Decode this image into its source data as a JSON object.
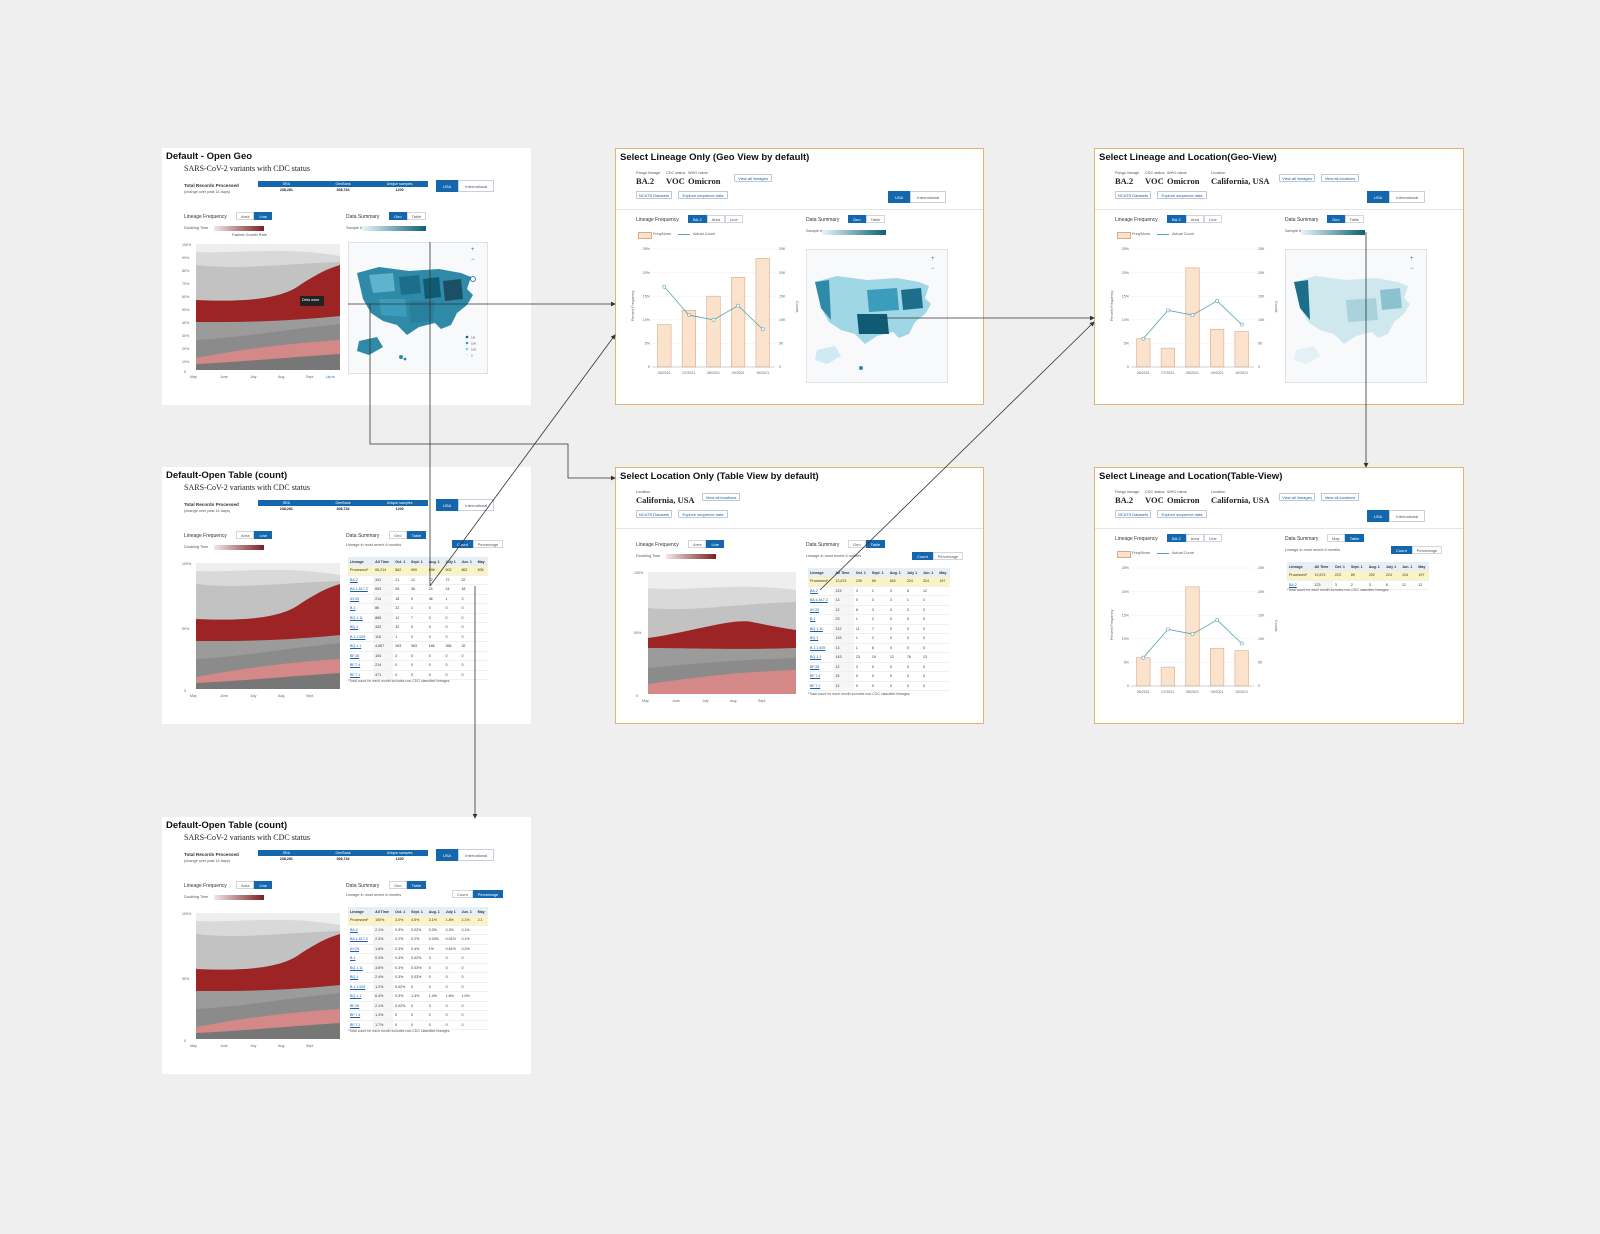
{
  "frames": {
    "f1": {
      "title": "Default - Open Geo",
      "subtitle": "SARS-CoV-2 variants with CDC status"
    },
    "f2": {
      "title": "Default-Open Table (count)",
      "subtitle": "SARS-CoV-2 variants with CDC status"
    },
    "f3": {
      "title": "Default-Open Table (count)",
      "subtitle": "SARS-CoV-2 variants with CDC status"
    },
    "f4": {
      "title": "Select Lineage Only (Geo View by default)"
    },
    "f5": {
      "title": "Select Location Only (Table View by default)"
    },
    "f6": {
      "title": "Select Lineage and Location(Geo-View)"
    },
    "f7": {
      "title": "Select Lineage and Location(Table-View)"
    }
  },
  "common": {
    "total_label": "Total Records Processed",
    "total_sub": "(change over past 14 days)",
    "stat_headers": [
      "SRA",
      "GenBank",
      "Unique samples"
    ],
    "stat_values": [
      "238,281",
      "308,734",
      "1200"
    ],
    "stat_suffix": "(+1.44%)",
    "usa": "USA",
    "international": "International",
    "lineage_frequency": "Lineage Frequency",
    "area": "Area",
    "line": "Line",
    "data_summary": "Data Summary",
    "geo": "Geo",
    "map": "Map",
    "table": "Table",
    "doubling_time": "Doubling Time",
    "fastest_growth": "Fastest Growth Rate",
    "sample_n": "Sample #",
    "sample_ticks": [
      "0",
      "1",
      "100",
      "1K",
      "10K",
      "100K",
      "1M+"
    ],
    "map_legend": [
      "1M",
      "10K",
      "100",
      "0"
    ],
    "lineage_recent": "Lineage in most recent 6 months",
    "count": "Count",
    "percentage": "Percentage",
    "footnote": "*Total count for each month includes non-CDC classified lineages.",
    "tooltip": "Delta wave\n(2/Mar)",
    "x_months": [
      "May\n2021",
      "June\n2021",
      "July\n2021",
      "Aug\n2021",
      "Sept\n2021",
      "Up to\nOct 31, 2021"
    ],
    "y_pct": [
      "100%",
      "90%",
      "80%",
      "70%",
      "60%",
      "50%",
      "40%",
      "30%",
      "20%",
      "10%",
      "0"
    ],
    "pango_label": "Pango lineage",
    "pango_value": "BA.2",
    "cdc_label": "CDC status",
    "cdc_value": "VOC",
    "who_label": "WHO name",
    "who_value": "Omicron",
    "location_label": "Location",
    "location_value": "California, USA",
    "view_all_lineages": "View all lineages",
    "view_all_locations": "View all locations",
    "ncats": "NCATS Datasets",
    "explore": "Explore sequence data",
    "ba2_tab": "BA.2",
    "freq_legend": "Freq/Norm",
    "actual_count": "Actual Count",
    "percent_frequency": "Percent Frequency",
    "counts_axis": "Counts",
    "bar_y_ticks": [
      "25%",
      "20%",
      "15%",
      "10%",
      "5%",
      "0"
    ],
    "bar_y2_ticks": [
      "25K",
      "20K",
      "15K",
      "10K",
      "5K",
      "0"
    ]
  },
  "table_count": {
    "headers": [
      "Lineage",
      "All Time",
      "Oct. 1",
      "Sept. 1",
      "Aug. 1",
      "July 1",
      "Jun. 1",
      "May"
    ],
    "rows": [
      [
        "Processed*",
        "65,214",
        "562",
        "690",
        "698",
        "502",
        "862",
        "836"
      ],
      [
        "BA.2",
        "341",
        "21",
        "12",
        "72",
        "72",
        "22",
        ""
      ],
      [
        "BA.1.617.2",
        "603",
        "26",
        "36",
        "24",
        "24",
        "18",
        ""
      ],
      [
        "AY.25",
        "214",
        "18",
        "9",
        "46",
        "1",
        "3",
        ""
      ],
      [
        "B.1",
        "86",
        "22",
        "1",
        "0",
        "0",
        "0",
        ""
      ],
      [
        "BQ.1.11",
        "865",
        "12",
        "7",
        "0",
        "0",
        "0",
        ""
      ],
      [
        "BQ.1",
        "432",
        "32",
        "0",
        "0",
        "0",
        "0",
        ""
      ],
      [
        "B.1.1.529",
        "116",
        "1",
        "0",
        "0",
        "0",
        "0",
        ""
      ],
      [
        "BQ.1.1",
        "4,567",
        "263",
        "363",
        "186",
        "366",
        "32",
        ""
      ],
      [
        "BF.26",
        "104",
        "2",
        "0",
        "0",
        "0",
        "0",
        ""
      ],
      [
        "BF.7.4",
        "214",
        "0",
        "0",
        "0",
        "0",
        "0",
        ""
      ],
      [
        "BF.7.1",
        "471",
        "0",
        "0",
        "0",
        "0",
        "0",
        ""
      ]
    ]
  },
  "table_pct": {
    "headers": [
      "Lineage",
      "All Time",
      "Oct. 1",
      "Sept. 1",
      "Aug. 1",
      "July 1",
      "Jun. 1",
      "May"
    ],
    "rows": [
      [
        "Processed*",
        "100%",
        "3.0%",
        "4.5%",
        "3.1%",
        "1.8%",
        "2.1%",
        "2.1"
      ],
      [
        "BA.2",
        "2.1%",
        "0.3%",
        "0.02%",
        "0.3%",
        "0.3%",
        "0.1%",
        ""
      ],
      [
        "BA.1.617.2",
        "2.3%",
        "0.2%",
        "0.2%",
        "0.03%",
        "0.01%",
        "0.1%",
        ""
      ],
      [
        "AY.25",
        "1.8%",
        "0.3%",
        "0.4%",
        "1%",
        "0.61%",
        "0.2%",
        ""
      ],
      [
        "B.1",
        "0.3%",
        "0.3%",
        "0.02%",
        "0",
        "0",
        "0",
        ""
      ],
      [
        "BQ.1.11",
        "3.6%",
        "0.3%",
        "0.03%",
        "0",
        "0",
        "0",
        ""
      ],
      [
        "BQ.1",
        "2.4%",
        "0.3%",
        "0.03%",
        "0",
        "0",
        "0",
        ""
      ],
      [
        "B.1.1.529",
        "1.2%",
        "0.02%",
        "0",
        "0",
        "0",
        "0",
        ""
      ],
      [
        "BQ.1.1",
        "6.4%",
        "0.3%",
        "1.4%",
        "1.4%",
        "1.6%",
        "1.0%",
        ""
      ],
      [
        "BF.26",
        "2.1%",
        "0.02%",
        "0",
        "0",
        "0",
        "0",
        ""
      ],
      [
        "BF.7.4",
        "1.3%",
        "0",
        "0",
        "0",
        "0",
        "0",
        ""
      ],
      [
        "BF.7.1",
        "1.7%",
        "0",
        "0",
        "0",
        "0",
        "0",
        ""
      ]
    ]
  },
  "table_loc": {
    "headers": [
      "Lineage",
      "All Time",
      "Oct. 1",
      "Sept. 1",
      "Aug. 1",
      "July 1",
      "Jun. 1",
      "May"
    ],
    "rows": [
      [
        "Processed*",
        "12,674",
        "235",
        "89",
        "602",
        "224",
        "324",
        "197"
      ],
      [
        "BA.2",
        "123",
        "3",
        "2",
        "3",
        "6",
        "12",
        ""
      ],
      [
        "BA.1.617.2",
        "13",
        "0",
        "3",
        "3",
        "1",
        "2",
        ""
      ],
      [
        "AY.25",
        "12",
        "6",
        "3",
        "3",
        "3",
        "0",
        ""
      ],
      [
        "B.1",
        "23",
        "1",
        "2",
        "0",
        "0",
        "0",
        ""
      ],
      [
        "BQ.1.11",
        "212",
        "11",
        "7",
        "0",
        "0",
        "0",
        ""
      ],
      [
        "BQ.1",
        "133",
        "1",
        "2",
        "0",
        "0",
        "0",
        ""
      ],
      [
        "B.1.1.529",
        "13",
        "1",
        "6",
        "0",
        "0",
        "0",
        ""
      ],
      [
        "BQ.1.1",
        "143",
        "23",
        "19",
        "12",
        "76",
        "13",
        ""
      ],
      [
        "BF.26",
        "12",
        "3",
        "0",
        "0",
        "0",
        "0",
        ""
      ],
      [
        "BF.7.4",
        "24",
        "0",
        "0",
        "0",
        "0",
        "0",
        ""
      ],
      [
        "BF.7.1",
        "12",
        "0",
        "0",
        "0",
        "0",
        "0",
        ""
      ]
    ]
  },
  "table_single": {
    "headers": [
      "Lineage",
      "All Time",
      "Oct. 1",
      "Sept. 1",
      "Aug. 1",
      "July 1",
      "Jun. 1",
      "May"
    ],
    "rows": [
      [
        "Processed*",
        "12,674",
        "223",
        "89",
        "202",
        "224",
        "124",
        "197"
      ],
      [
        "BA.2",
        "123",
        "3",
        "2",
        "3",
        "6",
        "12",
        "12"
      ]
    ]
  },
  "chart_data": [
    {
      "type": "bar",
      "id": "lineage-only",
      "categories": [
        "06/2021",
        "07/2021",
        "08/2021",
        "09/2021",
        "10/2021"
      ],
      "series": [
        {
          "name": "Freq/Norm",
          "values": [
            9,
            12,
            15,
            19,
            23
          ]
        }
      ],
      "line_counts": [
        17000,
        11000,
        10000,
        13000,
        8000
      ],
      "ylabel": "Percent Frequency",
      "y2label": "Counts",
      "ylim": [
        0,
        25
      ],
      "y2lim": [
        0,
        25000
      ],
      "colors": {
        "bar": "#fbe2cc",
        "bar_edge": "#d9a98a",
        "line": "#5aa3b3"
      }
    },
    {
      "type": "bar",
      "id": "lineage-location",
      "categories": [
        "06/2021",
        "07/2021",
        "08/2021",
        "09/2021",
        "10/2021"
      ],
      "series": [
        {
          "name": "Freq/Norm",
          "values": [
            6,
            4,
            21,
            8,
            7.5
          ]
        }
      ],
      "line_counts": [
        6000,
        12000,
        11000,
        14000,
        9000
      ],
      "ylabel": "Percent Frequency",
      "y2label": "Counts",
      "ylim": [
        0,
        25
      ],
      "y2lim": [
        0,
        25000
      ],
      "colors": {
        "bar": "#fbe2cc",
        "bar_edge": "#d9a98a",
        "line": "#5aa3b3"
      }
    }
  ],
  "colors": {
    "accent": "#1466ad",
    "frame_border": "#e2b46e",
    "area_red": "#9c2424",
    "area_grey": "#8a8a8a"
  }
}
